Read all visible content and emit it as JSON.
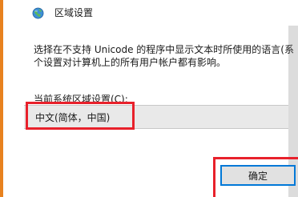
{
  "dialog": {
    "title": "区域设置",
    "icon": "globe-icon"
  },
  "description": {
    "line1": "选择在不支持 Unicode 的程序中显示文本时所使用的语言(系",
    "line2": "个设置对计算机上的所有用户帐户都有影响。"
  },
  "current_locale": {
    "label": "当前系统区域设置(C):",
    "value": "中文(简体，中国)"
  },
  "buttons": {
    "ok_label": "确定"
  },
  "colors": {
    "highlight": "#e8212b",
    "button_focus": "#0078d7",
    "accent_edge": "#e8821e"
  }
}
